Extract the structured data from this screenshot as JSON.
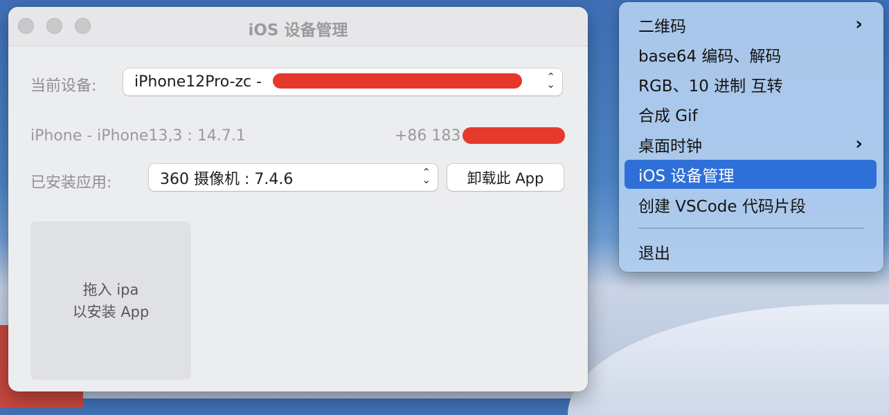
{
  "window": {
    "title": "iOS 设备管理",
    "current_device_label": "当前设备:",
    "current_device_value": "iPhone12Pro-zc -",
    "device_info": "iPhone - iPhone13,3 : 14.7.1",
    "phone_prefix": "+86 183",
    "installed_apps_label": "已安装应用:",
    "installed_app_value": "360 摄像机 : 7.4.6",
    "uninstall_button": "卸载此 App",
    "drop_zone_line1": "拖入 ipa",
    "drop_zone_line2": "以安装 App"
  },
  "menu": {
    "items": [
      {
        "label": "二维码",
        "submenu": true
      },
      {
        "label": "base64 编码、解码",
        "submenu": false
      },
      {
        "label": "RGB、10 进制 互转",
        "submenu": false
      },
      {
        "label": "合成 Gif",
        "submenu": false
      },
      {
        "label": "桌面时钟",
        "submenu": true
      },
      {
        "label": "iOS 设备管理",
        "submenu": false,
        "selected": true
      },
      {
        "label": "创建 VSCode 代码片段",
        "submenu": false
      }
    ],
    "quit": "退出"
  },
  "icons": {
    "submenu": "chevron-right-icon",
    "popup": "updown-chevron-icon"
  },
  "colors": {
    "selection": "#2f6fd8",
    "redaction": "#e5392c"
  }
}
